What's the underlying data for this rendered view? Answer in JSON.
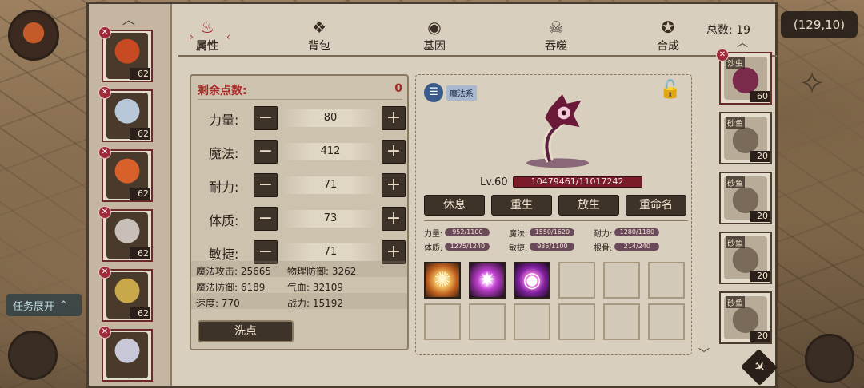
{
  "hud": {
    "coords": "(129,10)",
    "task_toggle": "任务展开",
    "task_toggle_icon": "chevron-up-icon",
    "compass_icon": "compass-icon"
  },
  "tabs": [
    {
      "label": "属性",
      "icon": "flame-icon",
      "active": true
    },
    {
      "label": "背包",
      "icon": "bag-icon",
      "active": false
    },
    {
      "label": "基因",
      "icon": "eye-icon",
      "active": false
    },
    {
      "label": "吞噬",
      "icon": "skull-icon",
      "active": false
    },
    {
      "label": "合成",
      "icon": "swirl-icon",
      "active": false
    }
  ],
  "tab_marks": {
    "left": "›",
    "right": "‹"
  },
  "total": {
    "label": "总数:",
    "value": "19"
  },
  "heroes": [
    {
      "level": "62",
      "color": "#c84a22"
    },
    {
      "level": "62",
      "color": "#b8c8d8"
    },
    {
      "level": "62",
      "color": "#d8602a"
    },
    {
      "level": "62",
      "color": "#c8c0b8"
    },
    {
      "level": "62",
      "color": "#c8a84a"
    },
    {
      "level": "",
      "color": "#c8c8d8"
    }
  ],
  "attributes": {
    "remaining_label": "剩余点数:",
    "remaining_value": "0",
    "rows": [
      {
        "label": "力量:",
        "value": "80"
      },
      {
        "label": "魔法:",
        "value": "412"
      },
      {
        "label": "耐力:",
        "value": "71"
      },
      {
        "label": "体质:",
        "value": "73"
      },
      {
        "label": "敏捷:",
        "value": "71"
      }
    ],
    "minus_symbol": "−",
    "plus_symbol": "+",
    "derived": [
      {
        "label": "魔法攻击:",
        "value": "25665"
      },
      {
        "label": "物理防御:",
        "value": "3262"
      },
      {
        "label": "魔法防御:",
        "value": "6189"
      },
      {
        "label": "气血:",
        "value": "32109"
      },
      {
        "label": "速度:",
        "value": "770"
      },
      {
        "label": "战力:",
        "value": "15192"
      }
    ],
    "reset_button": "洗点"
  },
  "pet": {
    "school_icon": "list-icon",
    "school": "魔法系",
    "lock_icon": "unlock-icon",
    "level": "Lv.60",
    "hp": "10479461/11017242",
    "actions": [
      "休息",
      "重生",
      "放生",
      "重命名"
    ],
    "aptitudes": [
      {
        "label": "力量:",
        "value": "952/1100"
      },
      {
        "label": "魔法:",
        "value": "1550/1620"
      },
      {
        "label": "耐力:",
        "value": "1280/1180"
      },
      {
        "label": "体质:",
        "value": "1275/1240"
      },
      {
        "label": "敏捷:",
        "value": "935/1100"
      },
      {
        "label": "根骨:",
        "value": "214/240"
      }
    ],
    "skills": [
      {
        "icon": "burst-icon",
        "glyph": "✺"
      },
      {
        "icon": "star-icon",
        "glyph": "✷"
      },
      {
        "icon": "orb-icon",
        "glyph": "◉"
      }
    ]
  },
  "pet_list": [
    {
      "name": "沙虫",
      "level": "60",
      "selected": true,
      "color": "#7a2a4a"
    },
    {
      "name": "砂鱼",
      "level": "20",
      "selected": false,
      "color": "#7a6a5a"
    },
    {
      "name": "砂鱼",
      "level": "20",
      "selected": false,
      "color": "#7a6a5a"
    },
    {
      "name": "砂鱼",
      "level": "20",
      "selected": false,
      "color": "#7a6a5a"
    },
    {
      "name": "砂鱼",
      "level": "20",
      "selected": false,
      "color": "#7a6a5a"
    }
  ],
  "arrows": {
    "up": "︿",
    "down": "﹀"
  },
  "share_icon": "share-icon"
}
